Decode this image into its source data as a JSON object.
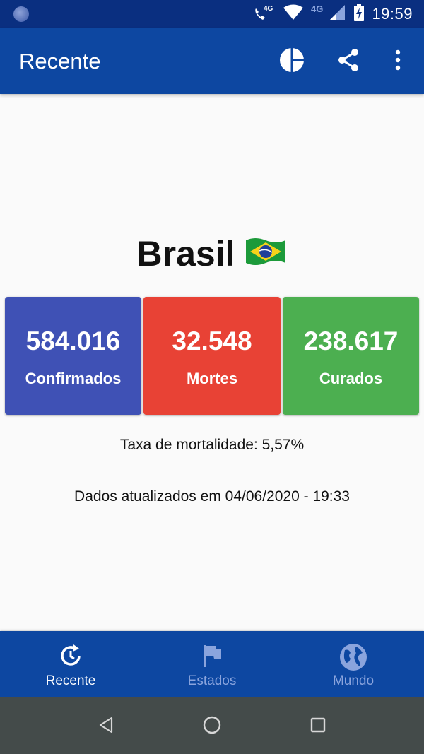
{
  "status_bar": {
    "network_label_1": "4G",
    "network_label_2": "4G",
    "time": "19:59",
    "icons": [
      "app-notification-icon",
      "call-4g-icon",
      "wifi-icon",
      "signal-icon",
      "battery-charging-icon"
    ]
  },
  "app_bar": {
    "title": "Recente",
    "actions": [
      "chart-icon",
      "share-icon",
      "more-vert-icon"
    ]
  },
  "main": {
    "country": "Brasil",
    "flag_icon": "brazil-flag-icon",
    "stats": [
      {
        "value": "584.016",
        "label": "Confirmados",
        "color": "#3f51b5"
      },
      {
        "value": "32.548",
        "label": "Mortes",
        "color": "#e84235"
      },
      {
        "value": "238.617",
        "label": "Curados",
        "color": "#4caf50"
      }
    ],
    "mortality": "Taxa de mortalidade: 5,57%",
    "updated": "Dados atualizados em 04/06/2020 - 19:33"
  },
  "bottom_nav": {
    "items": [
      {
        "label": "Recente",
        "icon": "history-icon",
        "active": true
      },
      {
        "label": "Estados",
        "icon": "flag-icon",
        "active": false
      },
      {
        "label": "Mundo",
        "icon": "globe-icon",
        "active": false
      }
    ],
    "active_color": "#ffffff",
    "inactive_color": "#8aa4dd"
  },
  "system_nav": [
    "back-icon",
    "home-icon",
    "recents-icon"
  ]
}
